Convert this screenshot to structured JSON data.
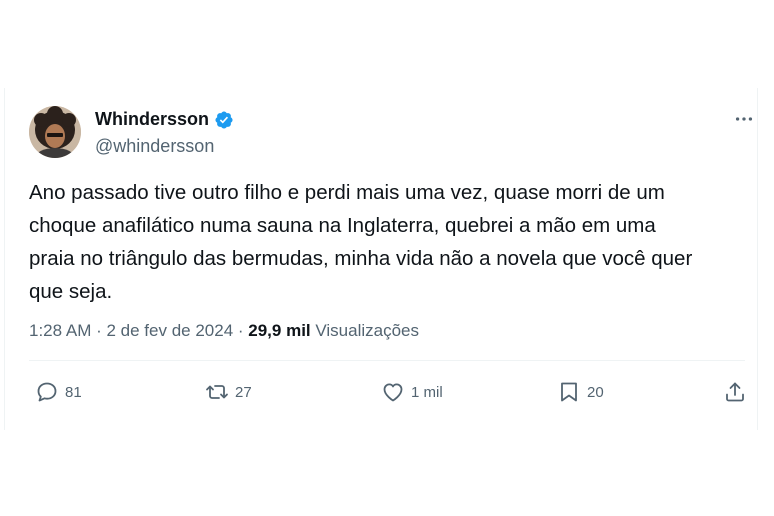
{
  "tweet": {
    "author": {
      "display_name": "Whindersson",
      "handle": "@whindersson",
      "verified": true
    },
    "text": "Ano passado tive outro filho e perdi mais uma vez, quase morri de um\nchoque anafilático numa sauna na Inglaterra, quebrei a mão em uma\npraia no triângulo das bermudas, minha vida não a novela que você quer\nque seja.",
    "meta": {
      "time": "1:28 AM",
      "separator": " · ",
      "date": "2 de fev de 2024",
      "views_count": "29,9 mil",
      "views_label": "Visualizações"
    },
    "more_icon": "more-horizontal-icon",
    "actions": {
      "replies": "81",
      "retweets": "27",
      "likes": "1 mil",
      "bookmarks": "20"
    }
  },
  "colors": {
    "text_primary": "#0f1419",
    "text_secondary": "#536471",
    "verified_badge": "#1d9bf0",
    "divider": "#eff3f4"
  }
}
